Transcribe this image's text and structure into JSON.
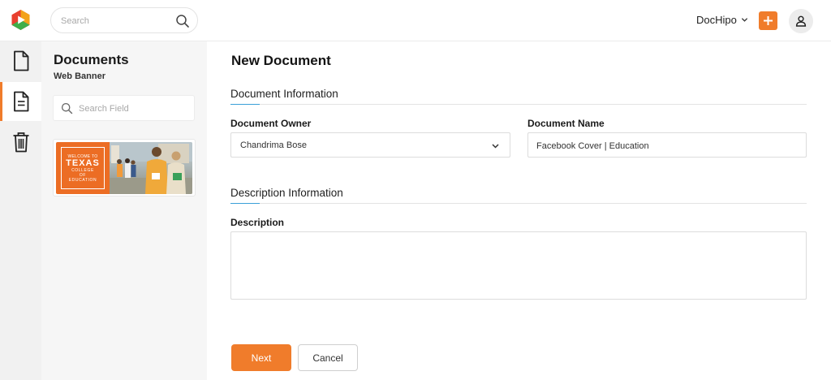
{
  "header": {
    "search_placeholder": "Search",
    "workspace_name": "DocHipo",
    "logo_icon": "dochipo-logo",
    "search_icon": "search-icon",
    "add_icon": "plus-icon",
    "user_icon": "user-icon"
  },
  "rail": {
    "items": [
      {
        "icon": "document-icon",
        "active": false
      },
      {
        "icon": "document-text-icon",
        "active": true
      },
      {
        "icon": "trash-icon",
        "active": false
      }
    ]
  },
  "panel": {
    "title": "Documents",
    "subtitle": "Web Banner",
    "search_placeholder": "Search Field",
    "template": {
      "line1": "WELCOME TO",
      "line2": "TEXAS",
      "line3": "COLLEGE",
      "line4": "OF",
      "line5": "EDUCATION"
    }
  },
  "main": {
    "title": "New Document",
    "document_info": {
      "heading": "Document Information",
      "owner_label": "Document Owner",
      "owner_value": "Chandrima Bose",
      "name_label": "Document Name",
      "name_value": "Facebook Cover | Education"
    },
    "description_info": {
      "heading": "Description Information",
      "description_label": "Description",
      "description_value": ""
    },
    "buttons": {
      "next": "Next",
      "cancel": "Cancel"
    }
  },
  "colors": {
    "accent": "#f07c2b",
    "section_rule_accent": "#3aa0d8",
    "rail_bg": "#f1f1f1",
    "panel_bg": "#f6f6f6"
  }
}
